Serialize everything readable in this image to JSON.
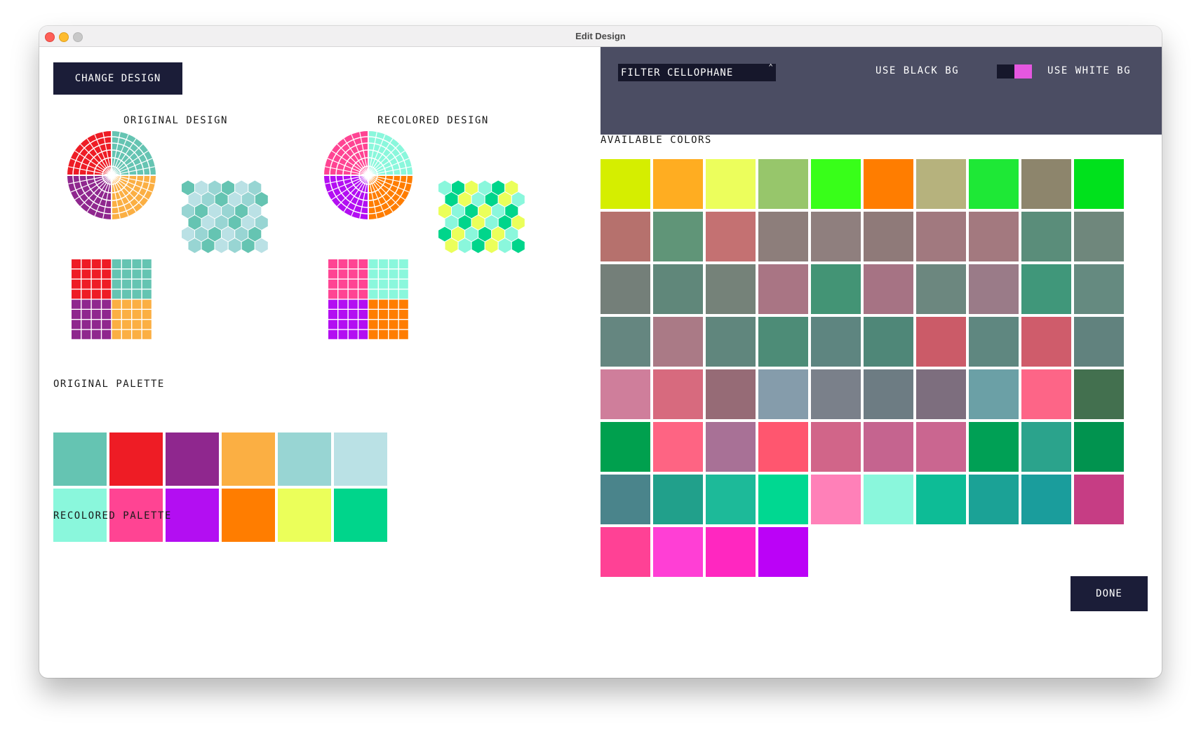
{
  "window": {
    "title": "Edit Design"
  },
  "left": {
    "change_design_label": "CHANGE DESIGN",
    "original_design_label": "ORIGINAL DESIGN",
    "recolored_design_label": "RECOLORED DESIGN",
    "original_palette_label": "ORIGINAL PALETTE",
    "recolored_palette_label": "RECOLORED PALETTE",
    "original_palette": [
      "#65c4b2",
      "#ee1c25",
      "#8f278e",
      "#fbaf43",
      "#98d5d3",
      "#bae1e5"
    ],
    "recolored_palette": [
      "#8af7dc",
      "#ff4493",
      "#b30ef2",
      "#ff7d00",
      "#ebff5a",
      "#00d58b"
    ]
  },
  "right": {
    "filter_value": "FILTER CELLOPHANE",
    "use_black_bg_label": "USE BLACK BG",
    "use_white_bg_label": "USE WHITE BG",
    "toggle_state": "white",
    "toggle_color": "#e557e0",
    "available_colors_label": "AVAILABLE COLORS",
    "available_colors": [
      "#d5ee00",
      "#ffad21",
      "#ecfe5c",
      "#97c66b",
      "#38ff19",
      "#ff7d00",
      "#b6b27d",
      "#1ee836",
      "#8d856c",
      "#00e11c",
      "#b6716d",
      "#609578",
      "#c47172",
      "#8d7e7b",
      "#8f7f7e",
      "#8f7a79",
      "#a1797f",
      "#a3797f",
      "#5a8d7a",
      "#6f877c",
      "#747f79",
      "#60877a",
      "#758279",
      "#a97584",
      "#439475",
      "#a67384",
      "#6c877f",
      "#9a7b88",
      "#40977a",
      "#658a80",
      "#658680",
      "#aa7a86",
      "#60867d",
      "#4d8c77",
      "#5e8580",
      "#4f8778",
      "#cb5b68",
      "#5f8780",
      "#cf5c6b",
      "#61827e",
      "#cf7e9b",
      "#d76a7e",
      "#966b76",
      "#859cab",
      "#7a808a",
      "#6d7c83",
      "#7d6e7e",
      "#6ba0a6",
      "#fd6587",
      "#43704f",
      "#00a04e",
      "#fe6483",
      "#a87196",
      "#ff566f",
      "#d16589",
      "#c5648f",
      "#ca6690",
      "#00a055",
      "#2ba38c",
      "#01934f",
      "#4a848b",
      "#21a08b",
      "#1dba99",
      "#00d891",
      "#ff80b8",
      "#8af7dc",
      "#0dbc96",
      "#1ba296",
      "#1a9d9c",
      "#c63d84",
      "#ff4195",
      "#ff3fd5",
      "#ff27c0",
      "#bb02f7"
    ]
  },
  "done_label": "DONE"
}
